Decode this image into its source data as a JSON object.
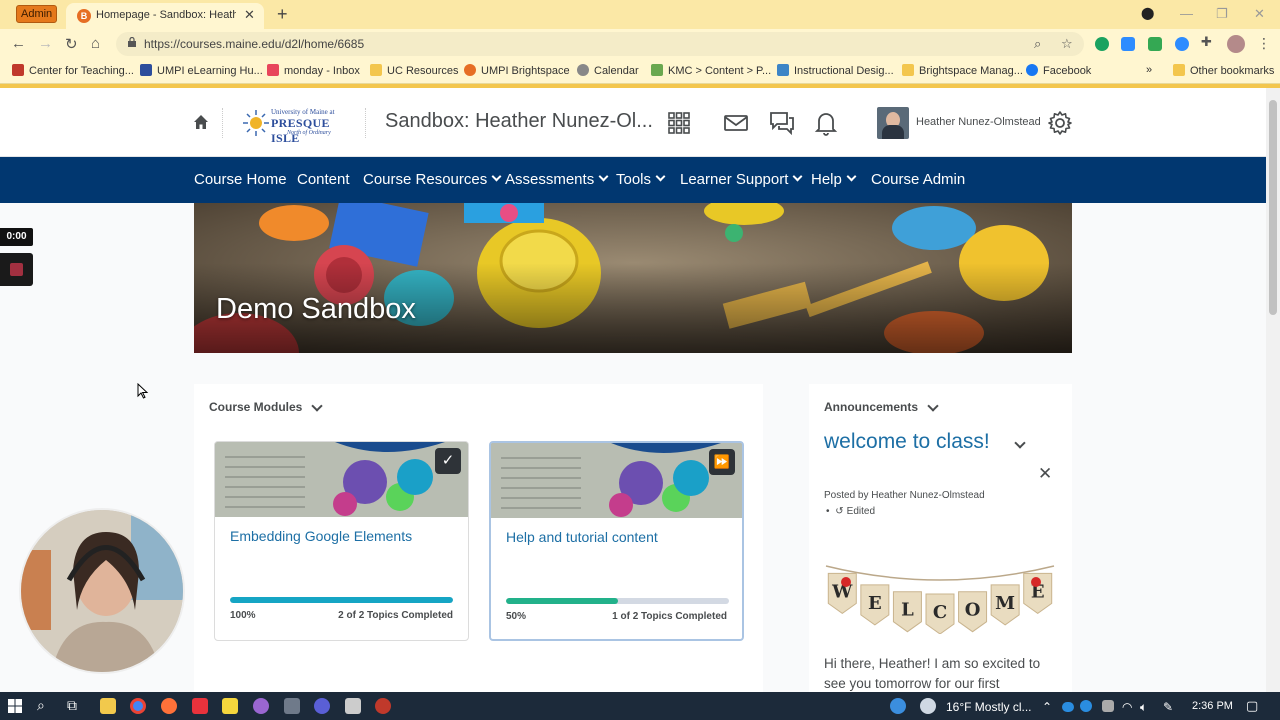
{
  "browser": {
    "admin_badge": "Admin",
    "tab_title": "Homepage - Sandbox: Heather N",
    "url": "https://courses.maine.edu/d2l/home/6685",
    "bookmarks": [
      {
        "label": "Center for Teaching...",
        "color": "#c0392b"
      },
      {
        "label": "UMPI eLearning Hu...",
        "color": "#2d4e9c"
      },
      {
        "label": "monday - Inbox",
        "color": "#e8465b"
      },
      {
        "label": "UC Resources",
        "color": "#f3c64d"
      },
      {
        "label": "UMPI Brightspace",
        "color": "#e66e24"
      },
      {
        "label": "Calendar",
        "color": "#888888"
      },
      {
        "label": "KMC > Content > P...",
        "color": "#6aa84f"
      },
      {
        "label": "Instructional Desig...",
        "color": "#3d85c6"
      },
      {
        "label": "Brightspace Manag...",
        "color": "#f3c64d"
      },
      {
        "label": "Facebook",
        "color": "#1877f2"
      }
    ],
    "bookmarks_more": "»",
    "other_bookmarks": "Other bookmarks"
  },
  "header": {
    "logo_line1": "University of Maine at",
    "logo_line2": "PRESQUE ISLE",
    "logo_line3": "North of Ordinary",
    "course_title": "Sandbox: Heather Nunez-Ol...",
    "user_name": "Heather Nunez-Olmstead"
  },
  "nav": {
    "items": [
      {
        "label": "Course Home",
        "dropdown": false
      },
      {
        "label": "Content",
        "dropdown": false
      },
      {
        "label": "Course Resources",
        "dropdown": true
      },
      {
        "label": "Assessments",
        "dropdown": true
      },
      {
        "label": "Tools",
        "dropdown": true
      },
      {
        "label": "Learner Support",
        "dropdown": true
      },
      {
        "label": "Help",
        "dropdown": true
      },
      {
        "label": "Course Admin",
        "dropdown": false
      }
    ]
  },
  "banner": {
    "title": "Demo Sandbox"
  },
  "modules": {
    "heading": "Course Modules",
    "cards": [
      {
        "title": "Embedding Google Elements",
        "progress": 1.0,
        "percent_label": "100%",
        "topics_label": "2 of 2 Topics Completed",
        "badge": "✓"
      },
      {
        "title": "Help and tutorial content",
        "progress": 0.5,
        "percent_label": "50%",
        "topics_label": "1 of 2 Topics Completed",
        "badge": "⏩"
      }
    ]
  },
  "announcements": {
    "heading": "Announcements",
    "title": "welcome to class!",
    "posted_by": "Posted by Heather Nunez-Olmstead",
    "edited": "Edited",
    "banner_letters": [
      "W",
      "E",
      "L",
      "C",
      "O",
      "M",
      "E"
    ],
    "body": "Hi there, Heather!  I am so excited to see you tomorrow for our first"
  },
  "recorder": {
    "timer": "0:00"
  },
  "taskbar": {
    "weather": "16°F  Mostly cl...",
    "time": "2:36 PM"
  }
}
